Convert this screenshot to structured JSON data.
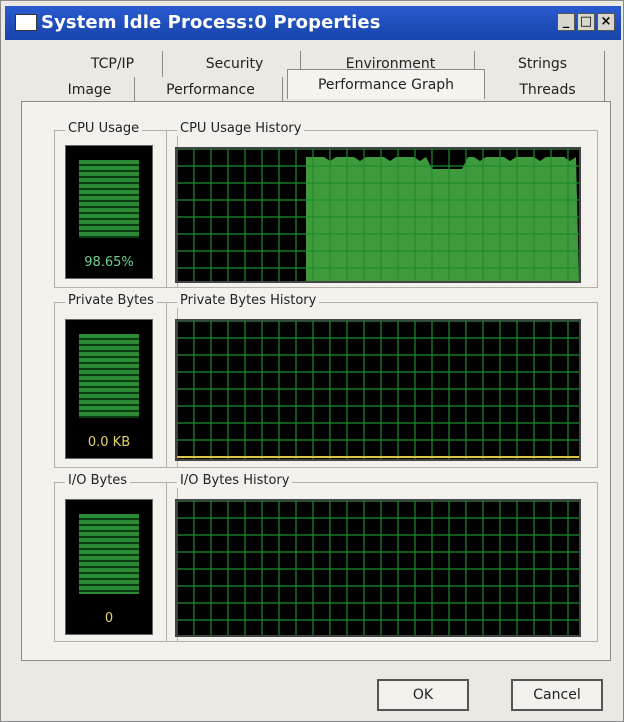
{
  "window": {
    "title": "System Idle Process:0 Properties"
  },
  "titlebar_buttons": {
    "minimize": "_",
    "maximize": "□",
    "close": "×"
  },
  "tabs_row1": [
    "TCP/IP",
    "Security",
    "Environment",
    "Strings"
  ],
  "tabs_row2": [
    "Image",
    "Performance",
    "Performance Graph",
    "Threads"
  ],
  "active_tab": "Performance Graph",
  "panels": {
    "cpu": {
      "meter_label": "CPU Usage",
      "meter_value": "98.65%",
      "history_label": "CPU Usage History",
      "history_fill_fraction_start": 0.32
    },
    "private": {
      "meter_label": "Private Bytes",
      "meter_value": "0.0 KB",
      "history_label": "Private Bytes History"
    },
    "io": {
      "meter_label": "I/O Bytes",
      "meter_value": "0",
      "history_label": "I/O Bytes History"
    }
  },
  "buttons": {
    "ok": "OK",
    "cancel": "Cancel"
  },
  "colors": {
    "grid": "#1f8d2c",
    "fill": "#3f9a3d",
    "meter_text_green": "#6fd08a",
    "meter_text_yellow": "#e6d36a",
    "baseline_yellow": "#d9c84a"
  }
}
